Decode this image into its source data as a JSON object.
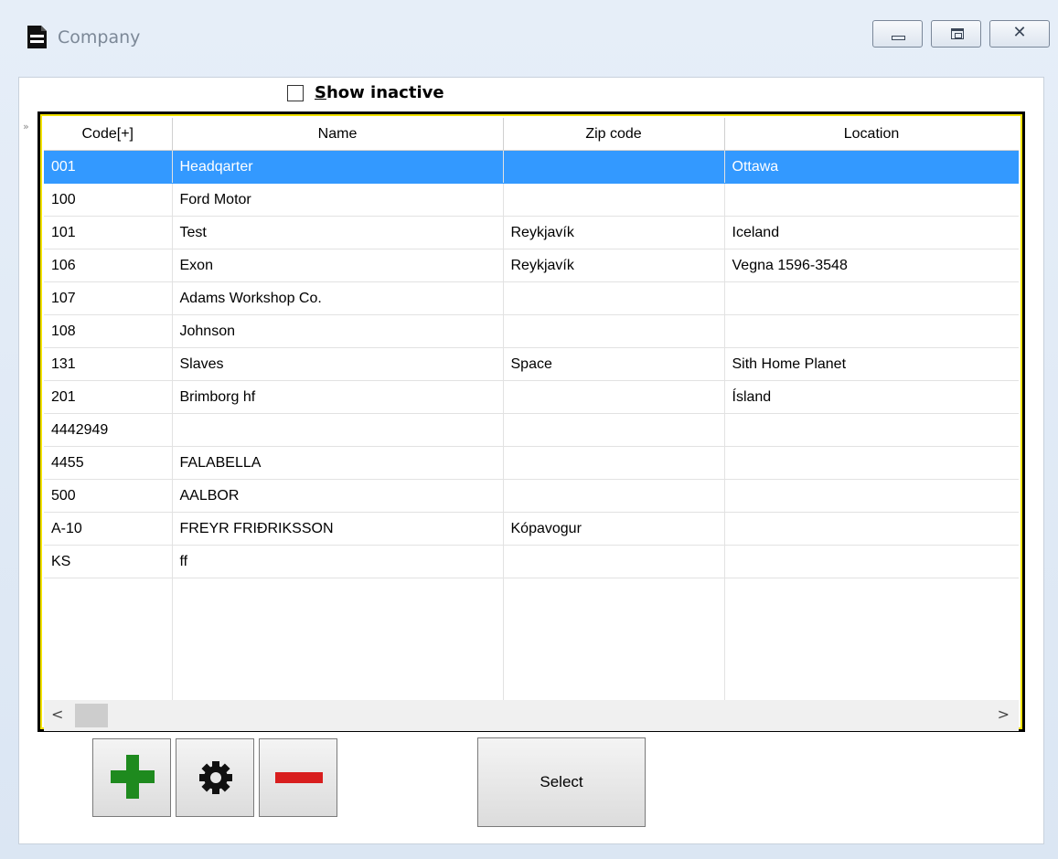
{
  "window": {
    "title": "Company",
    "controls": {
      "close_glyph": "✕"
    }
  },
  "filter": {
    "checkbox_label_accel": "S",
    "checkbox_label_rest": "how inactive",
    "checked": false
  },
  "grid": {
    "columns": [
      "Code[+]",
      "Name",
      "Zip code",
      "Location"
    ],
    "rows": [
      {
        "code": "001",
        "name": "Headqarter",
        "zip": "",
        "location": "Ottawa",
        "selected": true
      },
      {
        "code": "100",
        "name": "Ford Motor",
        "zip": "",
        "location": ""
      },
      {
        "code": "101",
        "name": "Test",
        "zip": "Reykjavík",
        "location": "Iceland"
      },
      {
        "code": "106",
        "name": "Exon",
        "zip": "Reykjavík",
        "location": "Vegna 1596-3548"
      },
      {
        "code": "107",
        "name": "Adams Workshop Co.",
        "zip": "",
        "location": ""
      },
      {
        "code": "108",
        "name": "Johnson",
        "zip": "",
        "location": ""
      },
      {
        "code": "131",
        "name": "Slaves",
        "zip": "Space",
        "location": "Sith Home Planet"
      },
      {
        "code": "201",
        "name": "Brimborg hf",
        "zip": "",
        "location": "Ísland"
      },
      {
        "code": "4442949",
        "name": "",
        "zip": "",
        "location": ""
      },
      {
        "code": "4455",
        "name": "FALABELLA",
        "zip": "",
        "location": ""
      },
      {
        "code": "500",
        "name": "AALBOR",
        "zip": "",
        "location": ""
      },
      {
        "code": "A-10",
        "name": "FREYR FRIÐRIKSSON",
        "zip": "Kópavogur",
        "location": ""
      },
      {
        "code": "KS",
        "name": "ff",
        "zip": "",
        "location": ""
      }
    ],
    "selection_color": "#3399ff",
    "frame_color": "#f2e200"
  },
  "scrollbar": {
    "left_arrow": "<",
    "right_arrow": ">",
    "position_fraction": 0.0
  },
  "toolbar": {
    "add_icon": "plus-icon",
    "settings_icon": "gear-icon",
    "remove_icon": "minus-icon",
    "add_color": "#1e8a1e",
    "remove_color": "#d81e1e",
    "select_label": "Select"
  }
}
